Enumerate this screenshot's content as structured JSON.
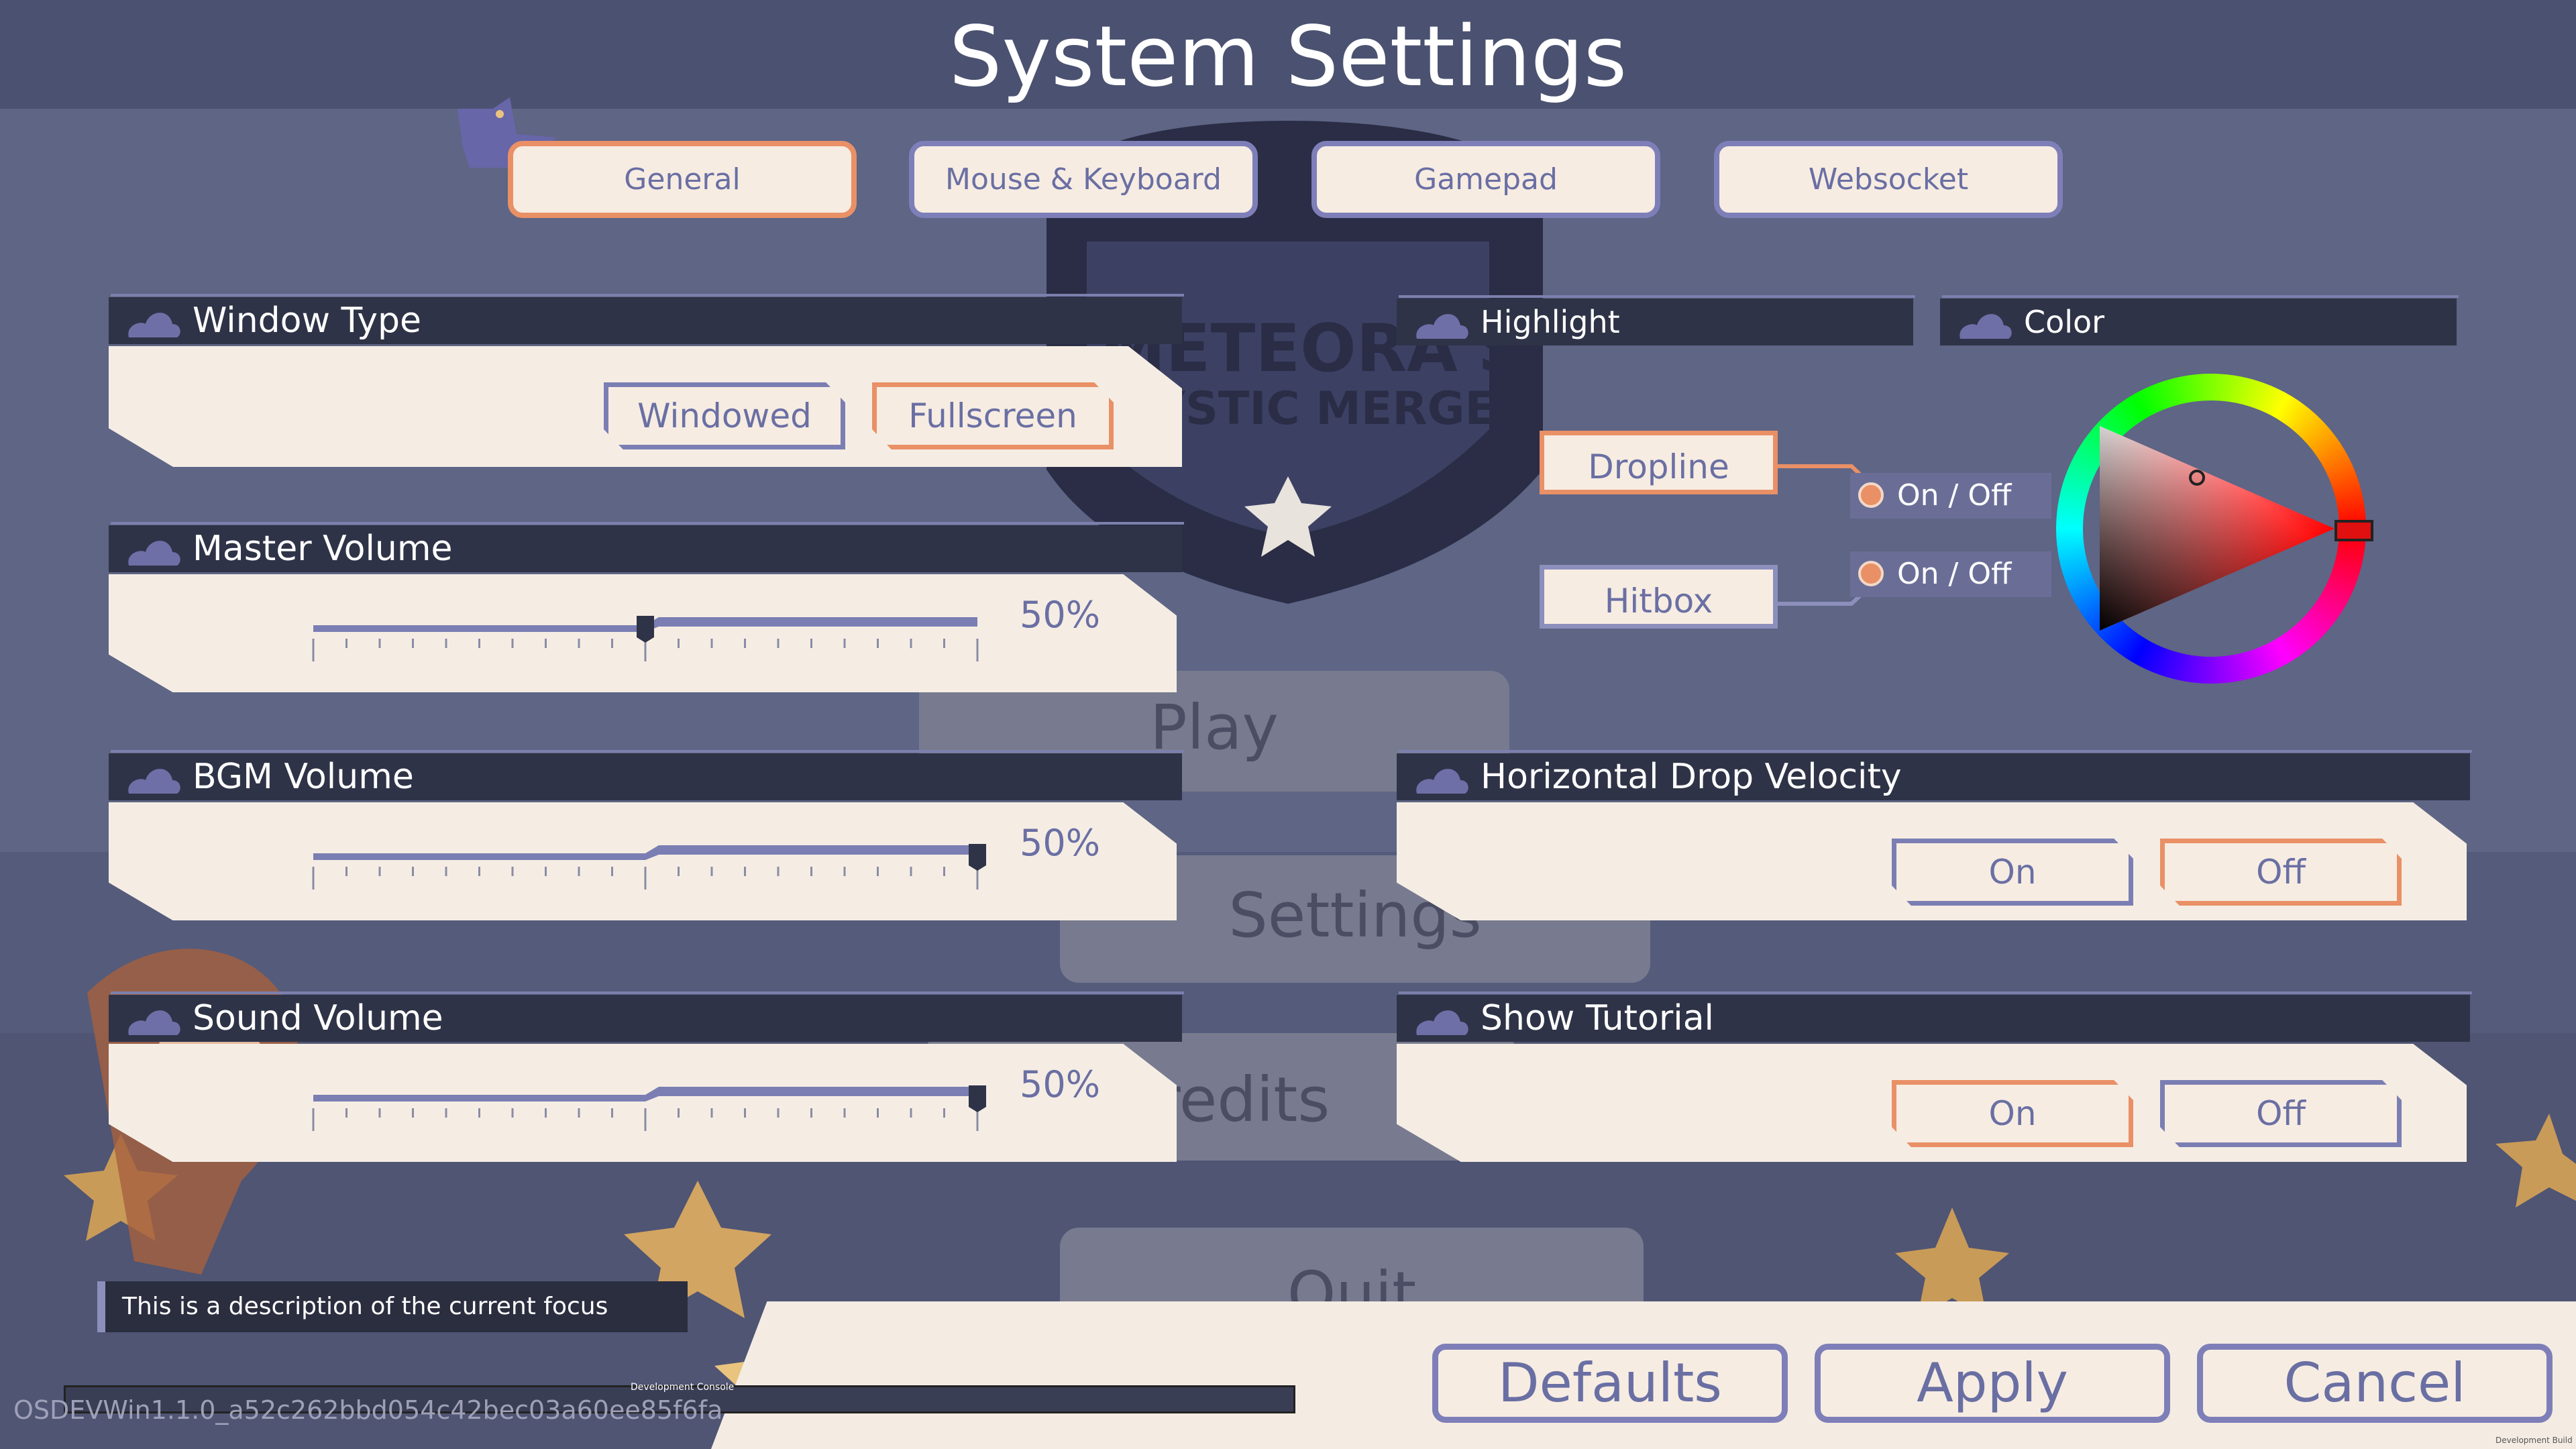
{
  "title": "System Settings",
  "tabs": [
    "General",
    "Mouse & Keyboard",
    "Gamepad",
    "Websocket"
  ],
  "active_tab": "General",
  "background_menu": {
    "logo_line1": "METEORA'S",
    "logo_line2": "MYSTIC MERGE",
    "play": "Play",
    "settings": "Settings",
    "credits": "Credits",
    "quit": "Quit"
  },
  "window_type": {
    "label": "Window Type",
    "options": [
      "Windowed",
      "Fullscreen"
    ],
    "selected": "Fullscreen"
  },
  "master_volume": {
    "label": "Master Volume",
    "value": "50%",
    "level": 0.5
  },
  "bgm_volume": {
    "label": "BGM Volume",
    "value": "50%",
    "level": 0.5
  },
  "sound_volume": {
    "label": "Sound Volume",
    "value": "50%",
    "level": 0.5
  },
  "highlight": {
    "label": "Highlight",
    "dropline": "Dropline",
    "hitbox": "Hitbox",
    "dropline_toggle": "On / Off",
    "hitbox_toggle": "On / Off"
  },
  "color": {
    "label": "Color",
    "selected": "#e01010"
  },
  "horizontal_drop_velocity": {
    "label": "Horizontal Drop Velocity",
    "on": "On",
    "off": "Off",
    "selected": "Off"
  },
  "show_tutorial": {
    "label": "Show Tutorial",
    "on": "On",
    "off": "Off",
    "selected": "On"
  },
  "description": "This is a description of the current focus",
  "console_label": "Development Console",
  "build_string": "OSDEVWin1.1.0_a52c262bbd054c42bec03a60ee85f6fa",
  "footer": {
    "defaults": "Defaults",
    "apply": "Apply",
    "cancel": "Cancel"
  },
  "dev_build": "Development Build",
  "colors": {
    "accent_selected": "#e99066",
    "accent_default": "#7e7fb8",
    "panel": "#f5ede4",
    "header": "#2f3347"
  }
}
